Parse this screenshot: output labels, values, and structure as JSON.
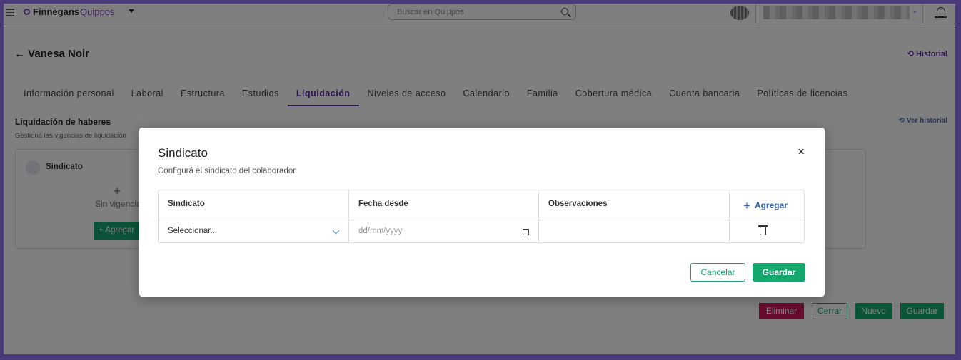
{
  "header": {
    "brand_a": "Finnegans",
    "brand_b": "Quippos",
    "search_placeholder": "Buscar en Quippos"
  },
  "page": {
    "title": "← Vanesa Noir",
    "historial": "Historial",
    "tabs": [
      {
        "label": "Información personal",
        "active": false
      },
      {
        "label": "Laboral",
        "active": false
      },
      {
        "label": "Estructura",
        "active": false
      },
      {
        "label": "Estudios",
        "active": false
      },
      {
        "label": "Liquidación",
        "active": true
      },
      {
        "label": "Niveles de acceso",
        "active": false
      },
      {
        "label": "Calendario",
        "active": false
      },
      {
        "label": "Familia",
        "active": false
      },
      {
        "label": "Cobertura médica",
        "active": false
      },
      {
        "label": "Cuenta bancaria",
        "active": false
      },
      {
        "label": "Políticas de licencias",
        "active": false
      }
    ],
    "section_title": "Liquidación de haberes",
    "section_subtitle": "Gestioná las vigencias de liquidación",
    "ver_historial": "Ver historial",
    "card": {
      "title": "Sindicato",
      "empty": "Sin vigencias",
      "add_label": "+ Agregar"
    },
    "actions": {
      "eliminar": "Eliminar",
      "cerrar": "Cerrar",
      "nuevo": "Nuevo",
      "guardar": "Guardar"
    }
  },
  "modal": {
    "title": "Sindicato",
    "subtitle": "Configurá el sindicato del colaborador",
    "close": "×",
    "columns": [
      "Sindicato",
      "Fecha desde",
      "Observaciones"
    ],
    "agregar": "Agregar",
    "row": {
      "sindicato_value": "Seleccionar...",
      "fecha_placeholder": "dd/mm/yyyy",
      "observaciones": ""
    },
    "cancel": "Cancelar",
    "save": "Guardar"
  },
  "colors": {
    "brand": "#7a3fb8",
    "primary_green": "#14a86f",
    "danger": "#d0185f",
    "link_blue": "#3666b4"
  },
  "icons": [
    "menu-icon",
    "logo-icon",
    "chevron-down-icon",
    "search-icon",
    "org-icon",
    "bell-icon",
    "history-icon",
    "document-icon",
    "plus-icon",
    "close-icon",
    "calendar-icon",
    "trash-icon"
  ]
}
